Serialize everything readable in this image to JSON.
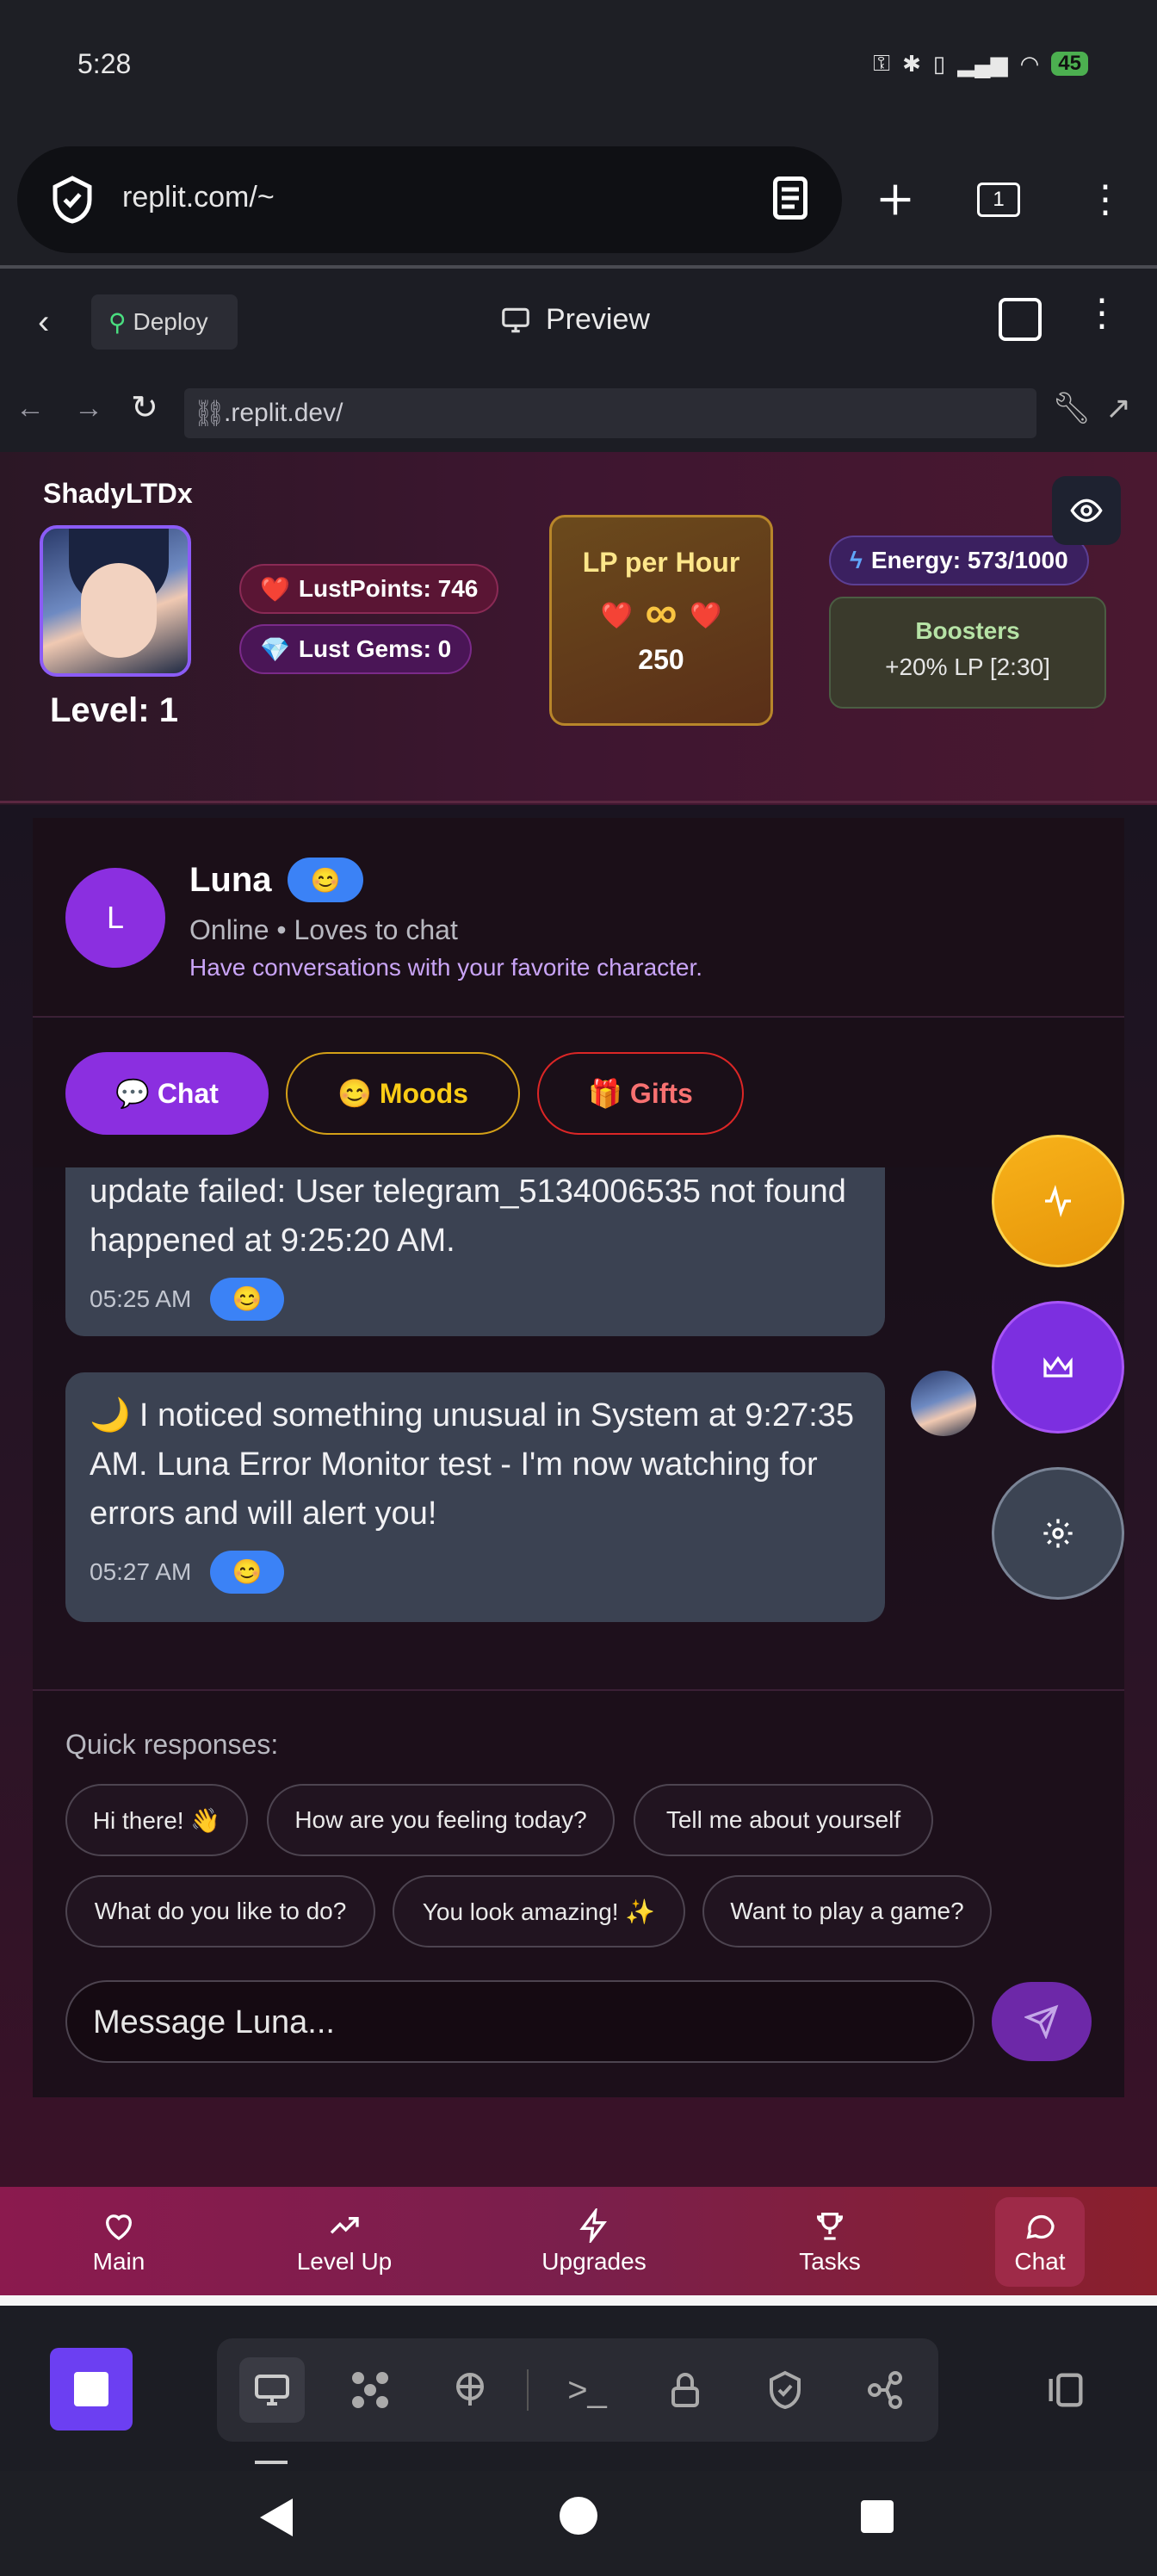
{
  "status_bar": {
    "time": "5:28",
    "battery": "45"
  },
  "browser": {
    "url": "replit.com/~",
    "tabs_count": "1"
  },
  "replit_header": {
    "deploy_label": "Deploy",
    "preview_label": "Preview",
    "dev_url": ".replit.dev/"
  },
  "game_header": {
    "player_name": "ShadyLTDx",
    "level": "Level: 1",
    "lust_points": "LustPoints: 746",
    "lust_gems": "Lust Gems: 0",
    "lp_per_hour_title": "LP per Hour",
    "lp_per_hour_symbol": "∞",
    "lp_per_hour_value": "250",
    "energy": "Energy: 573/1000",
    "boosters_title": "Boosters",
    "boosters_value": "+20% LP [2:30]"
  },
  "character": {
    "initial": "L",
    "name": "Luna",
    "mood_emoji": "😊",
    "status": "Online • Loves to chat",
    "description": "Have conversations with your favorite character."
  },
  "tabs": [
    {
      "label": "💬 Chat",
      "active": true
    },
    {
      "label": "😊 Moods",
      "active": false
    },
    {
      "label": "🎁 Gifts",
      "active": false
    }
  ],
  "messages": [
    {
      "text": "update failed: User telegram_5134006535 not found happened at 9:25:20 AM.",
      "time": "05:25 AM",
      "mood": "😊"
    },
    {
      "text": "🌙 I noticed something unusual in System at 9:27:35 AM. Luna Error Monitor test - I'm now watching for errors and will alert you!",
      "time": "05:27 AM",
      "mood": "😊"
    }
  ],
  "quick_responses": {
    "label": "Quick responses:",
    "items": [
      "Hi there! 👋",
      "How are you feeling today?",
      "Tell me about yourself",
      "What do you like to do?",
      "You look amazing! ✨",
      "Want to play a game?"
    ]
  },
  "composer": {
    "placeholder": "Message Luna..."
  },
  "bottom_nav": [
    "Main",
    "Level Up",
    "Upgrades",
    "Tasks",
    "Chat"
  ],
  "colors": {
    "accent_purple": "#8b2fe0",
    "mood_blue": "#3b82f6",
    "nav_gradient_start": "#8b1a4e",
    "lp_gold": "#f9c441"
  }
}
